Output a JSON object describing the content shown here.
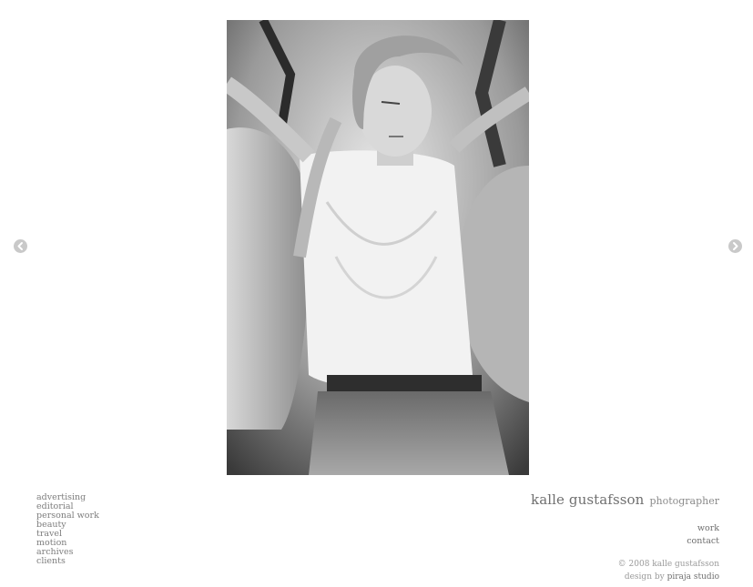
{
  "photo": {
    "alt_description": ""
  },
  "navigation": {
    "prev_icon": "chevron-left-circle",
    "next_icon": "chevron-right-circle"
  },
  "category_menu": {
    "items": [
      {
        "label": "advertising"
      },
      {
        "label": "editorial"
      },
      {
        "label": "personal work"
      },
      {
        "label": "beauty"
      },
      {
        "label": "travel"
      },
      {
        "label": "motion"
      },
      {
        "label": "archives"
      },
      {
        "label": "clients"
      }
    ]
  },
  "brand": {
    "name": "kalle gustafsson",
    "tagline": "photographer"
  },
  "main_nav": {
    "items": [
      {
        "label": "work"
      },
      {
        "label": "contact"
      }
    ]
  },
  "footer": {
    "copyright": "© 2008 kalle gustafsson",
    "design_prefix": "design by",
    "design_studio": "piraja studio"
  },
  "colors": {
    "background": "#ffffff",
    "text": "#7a7a7a",
    "arrow": "#c9c9c9"
  }
}
